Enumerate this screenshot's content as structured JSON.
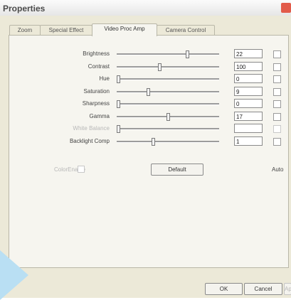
{
  "window": {
    "title": "Properties"
  },
  "tabs": [
    {
      "label": "Zoom"
    },
    {
      "label": "Special Effect"
    },
    {
      "label": "Video Proc Amp"
    },
    {
      "label": "Camera Control"
    }
  ],
  "controls": [
    {
      "name": "brightness",
      "label": "Brightness",
      "value": "22",
      "level": 0.7,
      "disabled": false
    },
    {
      "name": "contrast",
      "label": "Contrast",
      "value": "100",
      "level": 0.42,
      "disabled": false
    },
    {
      "name": "hue",
      "label": "Hue",
      "value": "0",
      "level": 0.0,
      "disabled": false
    },
    {
      "name": "saturation",
      "label": "Saturation",
      "value": "9",
      "level": 0.3,
      "disabled": false
    },
    {
      "name": "sharpness",
      "label": "Sharpness",
      "value": "0",
      "level": 0.0,
      "disabled": false
    },
    {
      "name": "gamma",
      "label": "Gamma",
      "value": "17",
      "level": 0.5,
      "disabled": false
    },
    {
      "name": "white-balance",
      "label": "White Balance",
      "value": "",
      "level": 0.0,
      "disabled": true
    },
    {
      "name": "backlight-comp",
      "label": "Backlight Comp",
      "value": "1",
      "level": 0.35,
      "disabled": false
    }
  ],
  "color_enable": {
    "label": "ColorEnable"
  },
  "default_button": {
    "label": "Default"
  },
  "auto_label": "Auto",
  "footer": {
    "ok_label": "OK",
    "cancel_label": "Cancel",
    "apply_label": "Apply"
  }
}
